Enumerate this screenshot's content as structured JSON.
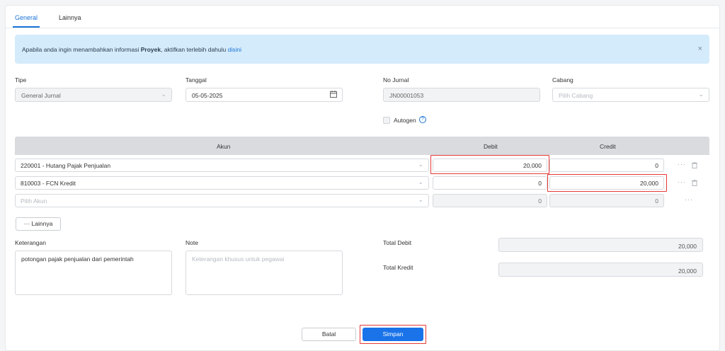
{
  "tabs": [
    {
      "label": "General"
    },
    {
      "label": "Lainnya"
    }
  ],
  "info": {
    "prefix": "Apabila anda ingin menambahkan informasi ",
    "bold": "Proyek",
    "middle": ", aktifkan terlebih dahulu ",
    "link": "disini",
    "close": "×"
  },
  "form": {
    "tipe": {
      "label": "Tipe",
      "value": "General Jurnal"
    },
    "tanggal": {
      "label": "Tanggal",
      "value": "05-05-2025"
    },
    "no_jurnal": {
      "label": "No Jurnal",
      "value": "JN00001053"
    },
    "cabang": {
      "label": "Cabang",
      "placeholder": "Pilih Cabang"
    },
    "autogen": {
      "label": "Autogen",
      "help": "?"
    }
  },
  "table": {
    "headers": {
      "akun": "Akun",
      "debit": "Debit",
      "credit": "Credit"
    },
    "rows": [
      {
        "akun": "220001 - Hutang Pajak Penjualan",
        "debit": "20,000",
        "credit": "0"
      },
      {
        "akun": "810003 - FCN Kredit",
        "debit": "0",
        "credit": "20,000"
      },
      {
        "akun": "Pilih Akun",
        "debit": "0",
        "credit": "0"
      }
    ],
    "more_label": "···",
    "lainnya_button": "··· Lainnya"
  },
  "keterangan": {
    "label": "Keterangan",
    "value": "potongan pajak penjualan dari pemerintah"
  },
  "note": {
    "label": "Note",
    "placeholder": "Keterangan khusus untuk pegawai"
  },
  "totals": {
    "debit_label": "Total Debit",
    "debit_value": "20,000",
    "kredit_label": "Total Kredit",
    "kredit_value": "20,000"
  },
  "actions": {
    "cancel": "Batal",
    "save": "Simpan"
  },
  "colors": {
    "accent": "#1a73e8",
    "highlight": "#e53935",
    "info_bg": "#d4ebfb"
  }
}
